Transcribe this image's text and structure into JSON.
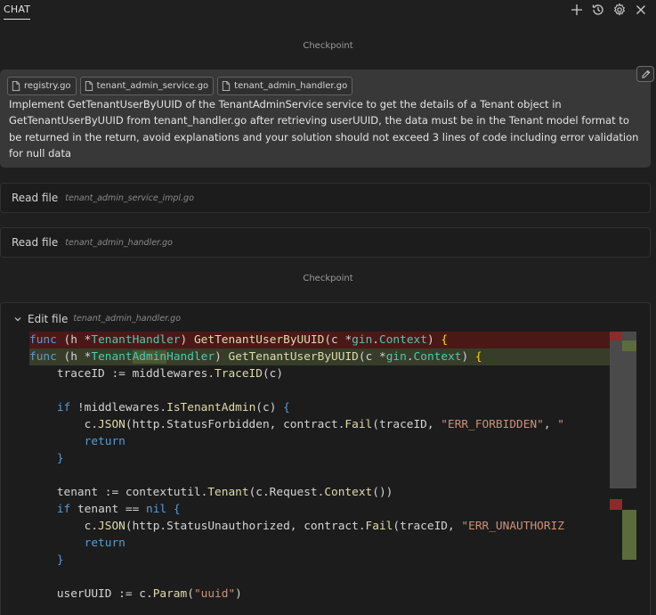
{
  "header": {
    "tab_label": "CHAT",
    "icons": [
      "plus-icon",
      "history-icon",
      "gear-icon",
      "close-icon"
    ]
  },
  "checkpoint_label": "Checkpoint",
  "prompt": {
    "attachments": [
      "registry.go",
      "tenant_admin_service.go",
      "tenant_admin_handler.go"
    ],
    "text": "Implement GetTenantUserByUUID of the TenantAdminService service to get the details of a Tenant object in GetTenantUserByUUID from tenant_handler.go after retrieving userUUID, the data must be in the Tenant model format to be returned in the return, avoid explanations and your solution should not exceed 3 lines of code including error validation for null data"
  },
  "steps": [
    {
      "action": "Read file",
      "file": "tenant_admin_service_impl.go"
    },
    {
      "action": "Read file",
      "file": "tenant_admin_handler.go"
    }
  ],
  "edit": {
    "action": "Edit file",
    "file": "tenant_admin_handler.go",
    "code_lines": [
      "func (h *TenantHandler) GetTenantUserByUUID(c *gin.Context) {",
      "func (h *TenantAdminHandler) GetTenantUserByUUID(c *gin.Context) {",
      "    traceID := middlewares.TraceID(c)",
      "",
      "    if !middlewares.IsTenantAdmin(c) {",
      "        c.JSON(http.StatusForbidden, contract.Fail(traceID, \"ERR_FORBIDDEN\", \"",
      "        return",
      "    }",
      "",
      "    tenant := contextutil.Tenant(c.Request.Context())",
      "    if tenant == nil {",
      "        c.JSON(http.StatusUnauthorized, contract.Fail(traceID, \"ERR_UNAUTHORIZ",
      "        return",
      "    }",
      "",
      "    userUUID := c.Param(\"uuid\")"
    ]
  },
  "colors": {
    "background": "#1f1f1f",
    "card": "#383838",
    "deleted_line": "#4b1818",
    "added_line": "#373d29",
    "keyword": "#569cd6",
    "type": "#4ec9b0",
    "function": "#dcdcaa",
    "string": "#ce9178"
  }
}
